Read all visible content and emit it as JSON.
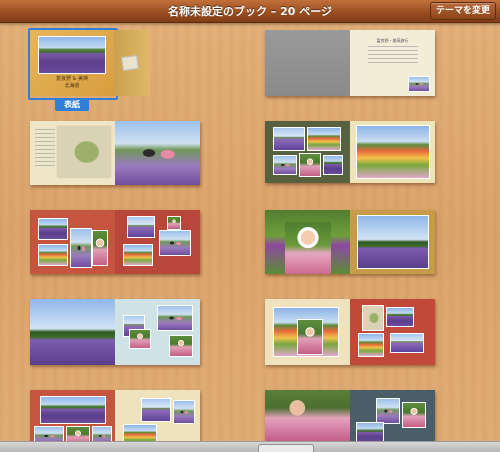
{
  "window": {
    "title": "名称未設定のブック – 20 ページ",
    "theme_button": "テーマを変更"
  },
  "cover": {
    "label": "表紙",
    "title_line1": "富良野 & 美瑛",
    "title_line2": "北海道"
  },
  "text_page": {
    "title": "富良野・美瑛旅行",
    "body": "ラベンダー畑"
  },
  "colors": {
    "titlebar": "#9d4f22",
    "selection": "#2f7fd8",
    "cover_label_bg": "#2f7fd8"
  }
}
